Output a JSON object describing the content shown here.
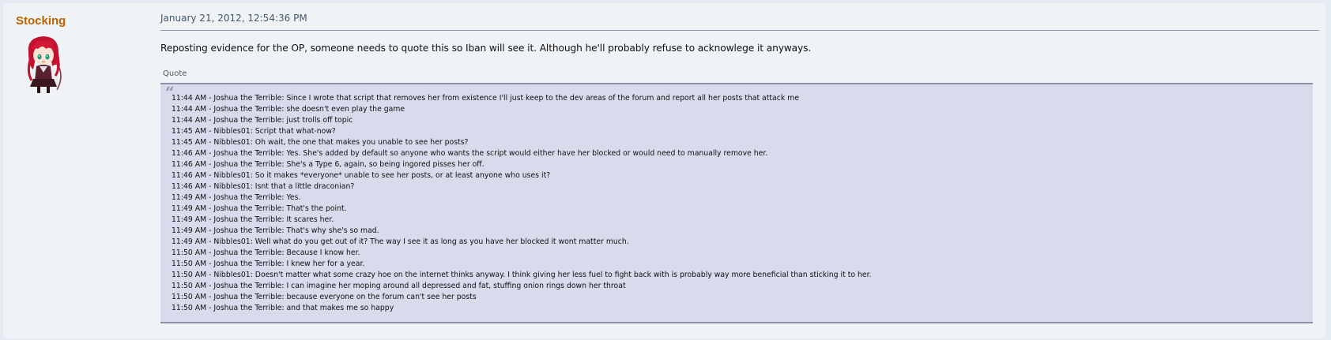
{
  "post": {
    "author": "Stocking",
    "date": "January 21, 2012, 12:54:36 PM",
    "body": "Reposting evidence for the OP, someone needs to quote this so Iban will see it. Although he'll probably refuse to acknowlege it anyways.",
    "quote": {
      "header": "Quote",
      "lines": [
        "11:44 AM - Joshua the Terrible: Since I wrote that script that removes her from existence I'll just keep to the dev areas of the forum and report all her posts that attack me",
        "11:44 AM - Joshua the Terrible: she doesn't even play the game",
        "11:44 AM - Joshua the Terrible: just trolls off topic",
        "11:45 AM - Nibbles01: Script that what-now?",
        "11:45 AM - Nibbles01: Oh wait, the one that makes you unable to see her posts?",
        "11:46 AM - Joshua the Terrible: Yes. She's added by default so anyone who wants the script would either have her blocked or would need to manually remove her.",
        "11:46 AM - Joshua the Terrible: She's a Type 6, again, so being ingored pisses her off.",
        "11:46 AM - Nibbles01: So it makes *everyone* unable to see her posts, or at least anyone who uses it?",
        "11:46 AM - Nibbles01: Isnt that a little draconian?",
        "11:49 AM - Joshua the Terrible: Yes.",
        "11:49 AM - Joshua the Terrible: That's the point.",
        "11:49 AM - Joshua the Terrible: It scares her.",
        "11:49 AM - Joshua the Terrible: That's why she's so mad.",
        "11:49 AM - Nibbles01: Well what do you get out of it? The way I see it as long as you have her blocked it wont matter much.",
        "11:50 AM - Joshua the Terrible: Because I know her.",
        "11:50 AM - Joshua the Terrible: I knew her for a year.",
        "11:50 AM - Nibbles01: Doesn't matter what some crazy hoe on the internet thinks anyway. I think giving her less fuel to fight back with is probably way more beneficial than sticking it to her.",
        "11:50 AM - Joshua the Terrible: I can imagine her moping around all depressed and fat, stuffing onion rings down her throat",
        "11:50 AM - Joshua the Terrible: because everyone on the forum can't see her posts",
        "11:50 AM - Joshua the Terrible: and that makes me so happy"
      ]
    }
  },
  "colors": {
    "author": "#c06000",
    "quote_bg": "#d7dbec",
    "page_bg": "#eff3f6"
  },
  "icons": {
    "avatar": "anime-girl-avatar",
    "quote_mark": "quote-mark-icon"
  }
}
